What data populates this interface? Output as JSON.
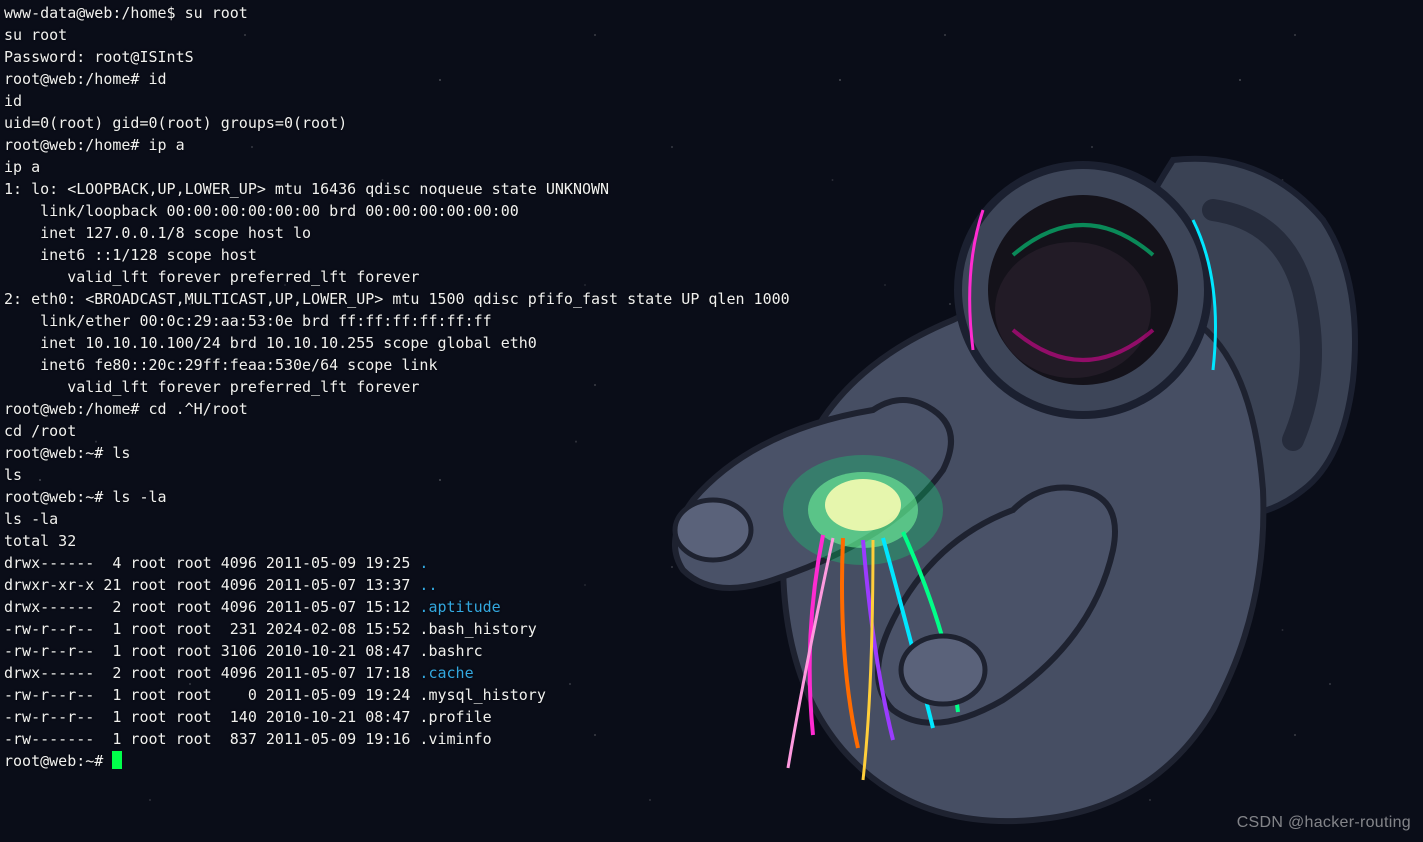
{
  "watermark": "CSDN @hacker-routing",
  "terminal": {
    "lines": [
      {
        "segs": [
          {
            "t": "www-data@web:/home$ su root"
          }
        ]
      },
      {
        "segs": [
          {
            "t": "su root"
          }
        ]
      },
      {
        "segs": [
          {
            "t": "Password: root@ISIntS"
          }
        ]
      },
      {
        "segs": [
          {
            "t": ""
          }
        ]
      },
      {
        "segs": [
          {
            "t": "root@web:/home# id"
          }
        ]
      },
      {
        "segs": [
          {
            "t": "id"
          }
        ]
      },
      {
        "segs": [
          {
            "t": "uid=0(root) gid=0(root) groups=0(root)"
          }
        ]
      },
      {
        "segs": [
          {
            "t": "root@web:/home# ip a"
          }
        ]
      },
      {
        "segs": [
          {
            "t": "ip a"
          }
        ]
      },
      {
        "segs": [
          {
            "t": "1: lo: <LOOPBACK,UP,LOWER_UP> mtu 16436 qdisc noqueue state UNKNOWN "
          }
        ]
      },
      {
        "segs": [
          {
            "t": "    link/loopback 00:00:00:00:00:00 brd 00:00:00:00:00:00"
          }
        ]
      },
      {
        "segs": [
          {
            "t": "    inet 127.0.0.1/8 scope host lo"
          }
        ]
      },
      {
        "segs": [
          {
            "t": "    inet6 ::1/128 scope host "
          }
        ]
      },
      {
        "segs": [
          {
            "t": "       valid_lft forever preferred_lft forever"
          }
        ]
      },
      {
        "segs": [
          {
            "t": "2: eth0: <BROADCAST,MULTICAST,UP,LOWER_UP> mtu 1500 qdisc pfifo_fast state UP qlen 1000"
          }
        ]
      },
      {
        "segs": [
          {
            "t": "    link/ether 00:0c:29:aa:53:0e brd ff:ff:ff:ff:ff:ff"
          }
        ]
      },
      {
        "segs": [
          {
            "t": "    inet 10.10.10.100/24 brd 10.10.10.255 scope global eth0"
          }
        ]
      },
      {
        "segs": [
          {
            "t": "    inet6 fe80::20c:29ff:feaa:530e/64 scope link "
          }
        ]
      },
      {
        "segs": [
          {
            "t": "       valid_lft forever preferred_lft forever"
          }
        ]
      },
      {
        "segs": [
          {
            "t": "root@web:/home# cd .^H/root"
          }
        ]
      },
      {
        "segs": [
          {
            "t": "cd /root"
          }
        ]
      },
      {
        "segs": [
          {
            "t": "root@web:~# ls"
          }
        ]
      },
      {
        "segs": [
          {
            "t": "ls"
          }
        ]
      },
      {
        "segs": [
          {
            "t": "root@web:~# ls -la"
          }
        ]
      },
      {
        "segs": [
          {
            "t": "ls -la"
          }
        ]
      },
      {
        "segs": [
          {
            "t": "total 32"
          }
        ]
      },
      {
        "segs": [
          {
            "t": "drwx------  4 root root 4096 2011-05-09 19:25 "
          },
          {
            "t": ".",
            "c": "dir"
          }
        ]
      },
      {
        "segs": [
          {
            "t": "drwxr-xr-x 21 root root 4096 2011-05-07 13:37 "
          },
          {
            "t": "..",
            "c": "dir"
          }
        ]
      },
      {
        "segs": [
          {
            "t": "drwx------  2 root root 4096 2011-05-07 15:12 "
          },
          {
            "t": ".aptitude",
            "c": "dir"
          }
        ]
      },
      {
        "segs": [
          {
            "t": "-rw-r--r--  1 root root  231 2024-02-08 15:52 .bash_history"
          }
        ]
      },
      {
        "segs": [
          {
            "t": "-rw-r--r--  1 root root 3106 2010-10-21 08:47 .bashrc"
          }
        ]
      },
      {
        "segs": [
          {
            "t": "drwx------  2 root root 4096 2011-05-07 17:18 "
          },
          {
            "t": ".cache",
            "c": "dir"
          }
        ]
      },
      {
        "segs": [
          {
            "t": "-rw-r--r--  1 root root    0 2011-05-09 19:24 .mysql_history"
          }
        ]
      },
      {
        "segs": [
          {
            "t": "-rw-r--r--  1 root root  140 2010-10-21 08:47 .profile"
          }
        ]
      },
      {
        "segs": [
          {
            "t": "-rw-------  1 root root  837 2011-05-09 19:16 .viminfo"
          }
        ]
      },
      {
        "segs": [
          {
            "t": "root@web:~# "
          }
        ],
        "cursor": true
      }
    ]
  }
}
